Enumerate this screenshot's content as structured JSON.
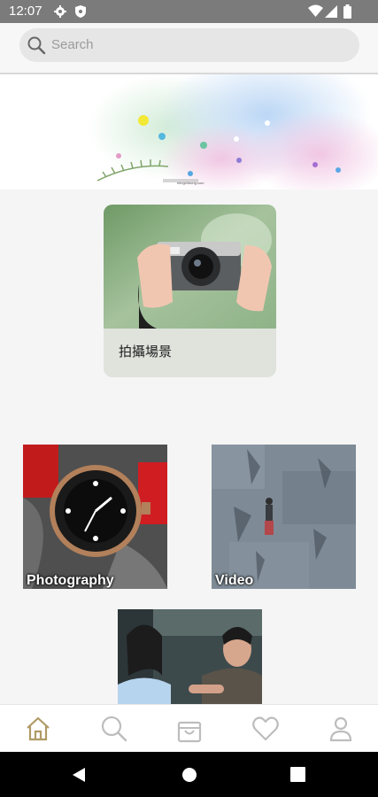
{
  "status_bar": {
    "time": "12:07"
  },
  "search": {
    "placeholder": "Search"
  },
  "banner": {
    "caption": "mingcheung.com"
  },
  "featured": {
    "label": "拍攝場景"
  },
  "tiles": [
    {
      "label": "Photography"
    },
    {
      "label": "Video"
    }
  ],
  "bottom_nav": {
    "items": [
      "home-icon",
      "search-icon",
      "bag-icon",
      "heart-icon",
      "profile-icon"
    ],
    "active_color": "#b09a66",
    "inactive_color": "#bdbdbd"
  },
  "colors": {
    "status_bar": "#7b7b7b",
    "background": "#f5f5f5"
  }
}
